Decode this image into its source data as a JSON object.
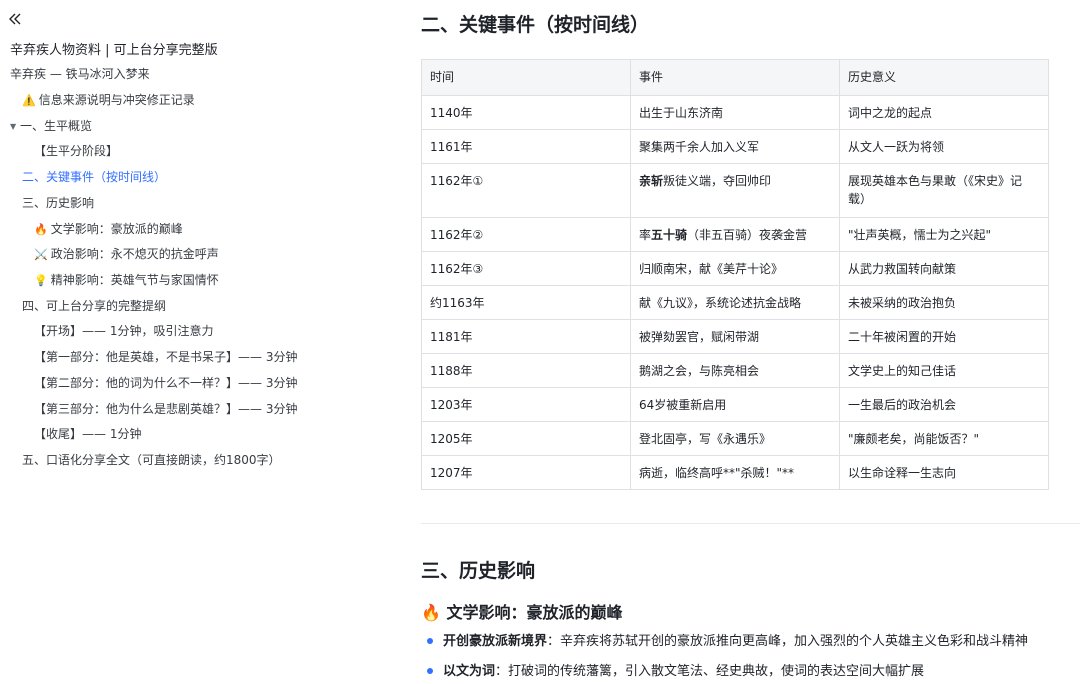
{
  "sidebar": {
    "collapse_icon": "double-chevron-left-icon",
    "doc_title": "辛弃疾人物资料 | 可上台分享完整版",
    "outline": [
      {
        "text": "辛弃疾 — 铁马冰河入梦来",
        "emoji": ""
      },
      {
        "text": "信息来源说明与冲突修正记录",
        "emoji": "⚠️"
      },
      {
        "text": "一、生平概览",
        "emoji": ""
      },
      {
        "text": "【生平分阶段】",
        "emoji": ""
      },
      {
        "text": "二、关键事件（按时间线）",
        "emoji": ""
      },
      {
        "text": "三、历史影响",
        "emoji": ""
      },
      {
        "text": "文学影响：豪放派的巅峰",
        "emoji": "🔥"
      },
      {
        "text": "政治影响：永不熄灭的抗金呼声",
        "emoji": "⚔️"
      },
      {
        "text": "精神影响：英雄气节与家国情怀",
        "emoji": "💡"
      },
      {
        "text": "四、可上台分享的完整提纲",
        "emoji": ""
      },
      {
        "text": "【开场】—— 1分钟，吸引注意力",
        "emoji": ""
      },
      {
        "text": "【第一部分：他是英雄，不是书呆子】—— 3分钟",
        "emoji": ""
      },
      {
        "text": "【第二部分：他的词为什么不一样？】—— 3分钟",
        "emoji": ""
      },
      {
        "text": "【第三部分：他为什么是悲剧英雄？】—— 3分钟",
        "emoji": ""
      },
      {
        "text": "【收尾】—— 1分钟",
        "emoji": ""
      },
      {
        "text": "五、口语化分享全文（可直接朗读，约1800字）",
        "emoji": ""
      }
    ],
    "active_color": "#3370ff"
  },
  "main": {
    "section2_title": "二、关键事件（按时间线）",
    "table": {
      "headers": [
        "时间",
        "事件",
        "历史意义"
      ],
      "rows": [
        {
          "time": "1140年",
          "event_pre": "",
          "event_bold": "",
          "event_post": "出生于山东济南",
          "meaning": "词中之龙的起点"
        },
        {
          "time": "1161年",
          "event_pre": "",
          "event_bold": "",
          "event_post": "聚集两千余人加入义军",
          "meaning": "从文人一跃为将领"
        },
        {
          "time": "1162年①",
          "event_pre": "",
          "event_bold": "亲斩",
          "event_post": "叛徒义端，夺回帅印",
          "meaning": "展现英雄本色与果敢（《宋史》记载）"
        },
        {
          "time": "1162年②",
          "event_pre": "率",
          "event_bold": "五十骑",
          "event_post": "（非五百骑）夜袭金营",
          "meaning": "\"壮声英概，懦士为之兴起\""
        },
        {
          "time": "1162年③",
          "event_pre": "",
          "event_bold": "",
          "event_post": "归顺南宋，献《美芹十论》",
          "meaning": "从武力救国转向献策"
        },
        {
          "time": "约1163年",
          "event_pre": "",
          "event_bold": "",
          "event_post": "献《九议》，系统论述抗金战略",
          "meaning": "未被采纳的政治抱负"
        },
        {
          "time": "1181年",
          "event_pre": "",
          "event_bold": "",
          "event_post": "被弹劾罢官，赋闲带湖",
          "meaning": "二十年被闲置的开始"
        },
        {
          "time": "1188年",
          "event_pre": "",
          "event_bold": "",
          "event_post": "鹅湖之会，与陈亮相会",
          "meaning": "文学史上的知己佳话"
        },
        {
          "time": "1203年",
          "event_pre": "",
          "event_bold": "",
          "event_post": "64岁被重新启用",
          "meaning": "一生最后的政治机会"
        },
        {
          "time": "1205年",
          "event_pre": "",
          "event_bold": "",
          "event_post": "登北固亭，写《永遇乐》",
          "meaning": "\"廉颇老矣，尚能饭否？\""
        },
        {
          "time": "1207年",
          "event_pre": "",
          "event_bold": "",
          "event_post": "病逝，临终高呼**\"杀贼！\"**",
          "meaning": "以生命诠释一生志向"
        }
      ]
    },
    "section3_title": "三、历史影响",
    "sub_heading": {
      "emoji": "🔥",
      "text": "文学影响：豪放派的巅峰"
    },
    "bullets": [
      {
        "bold": "开创豪放派新境界",
        "text": "：辛弃疾将苏轼开创的豪放派推向更高峰，加入强烈的个人英雄主义色彩和战斗精神"
      },
      {
        "bold": "以文为词",
        "text": "：打破词的传统藩篱，引入散文笔法、经史典故，使词的表达空间大幅扩展"
      }
    ]
  }
}
